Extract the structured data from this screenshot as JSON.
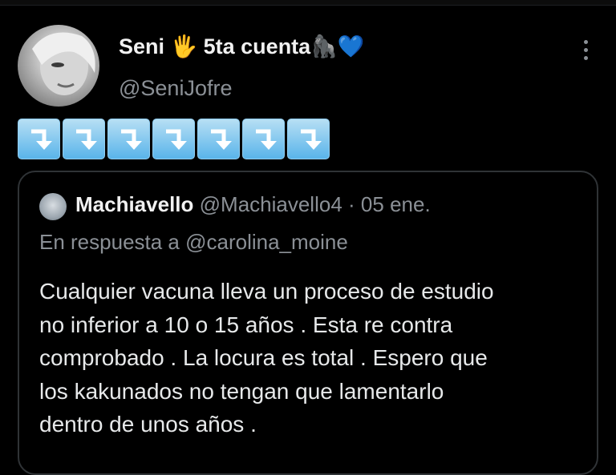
{
  "tweet": {
    "author_name": "Seni 🖐 5ta cuenta🦍💙",
    "author_handle": "@SeniJofre",
    "emoji_row": [
      "⤵️",
      "⤵️",
      "⤵️",
      "⤵️",
      "⤵️",
      "⤵️",
      "⤵️"
    ],
    "more_icon": "more-vertical-icon"
  },
  "quoted_tweet": {
    "author_name": "Machiavello",
    "author_handle": "@Machiavello4",
    "separator": "·",
    "date": "05 ene.",
    "reply_context": "En respuesta a @carolina_moine",
    "text_lines": [
      "Cualquier vacuna lleva un proceso de estudio",
      "no inferior a 10 o 15 años . Esta re contra",
      "comprobado . La locura es total . Espero que",
      "los kakunados no tengan que lamentarlo",
      "dentro de unos años ."
    ]
  },
  "colors": {
    "background": "#000000",
    "primary_text": "#e7e9ea",
    "secondary_text": "#8b9096",
    "border": "#2f3336",
    "emoji_key": "#59b4ea"
  }
}
